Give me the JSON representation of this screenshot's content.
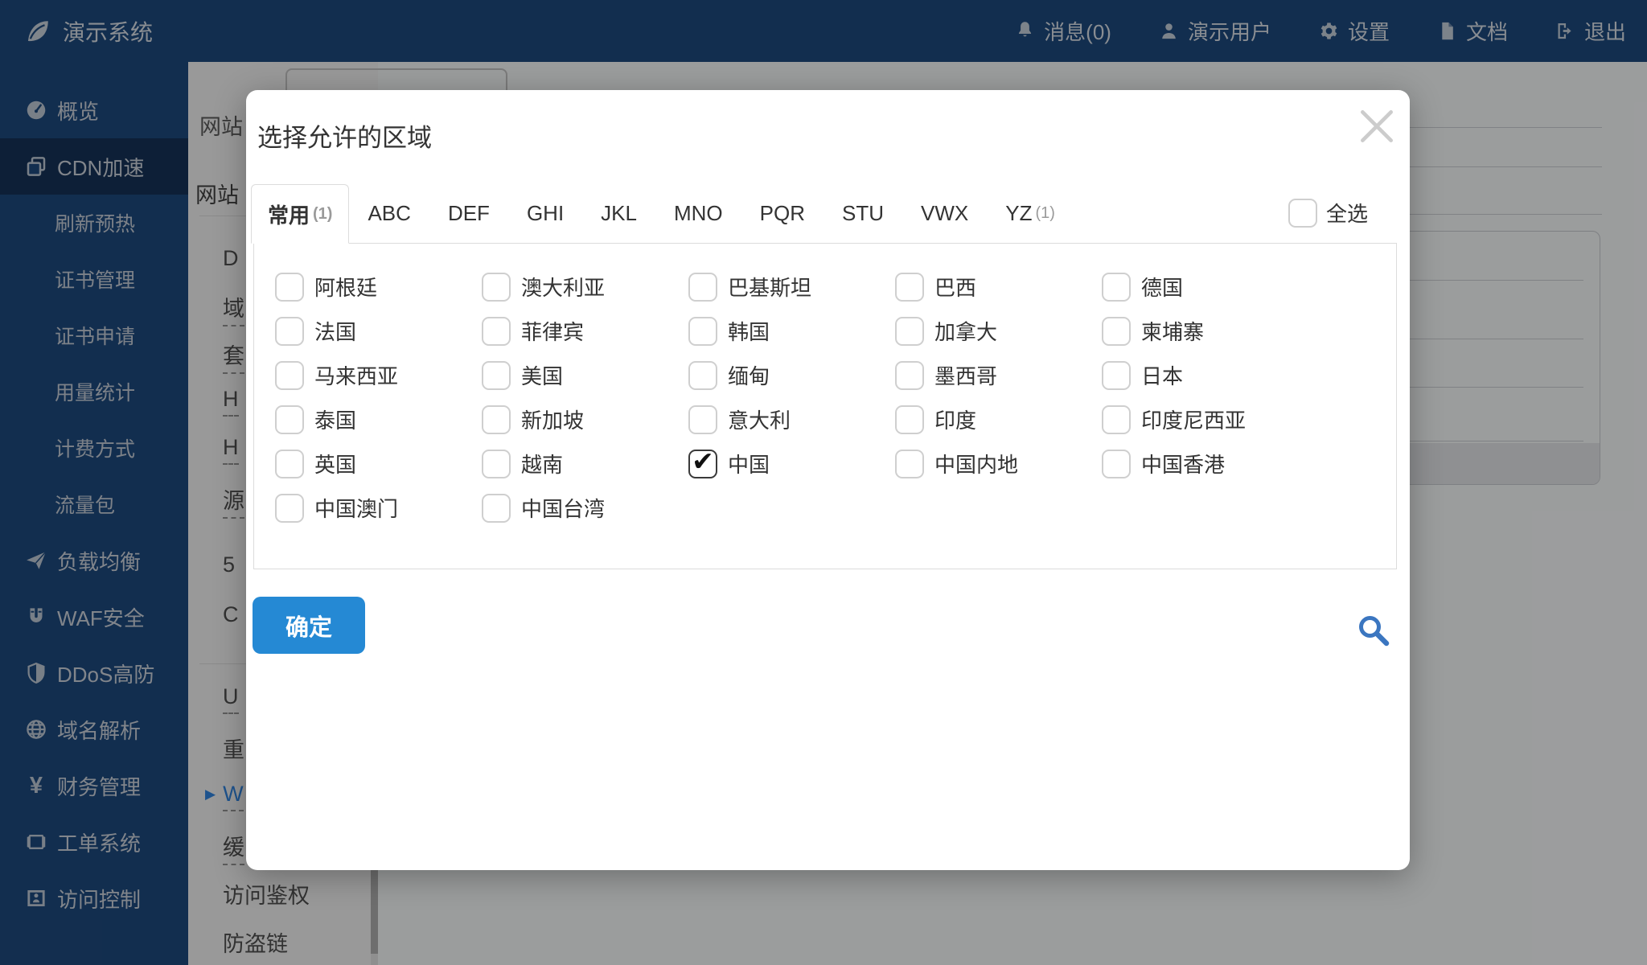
{
  "navbar": {
    "brand": "演示系统",
    "items": [
      {
        "icon": "bell-icon",
        "label": "消息(0)"
      },
      {
        "icon": "user-icon",
        "label": "演示用户"
      },
      {
        "icon": "gear-icon",
        "label": "设置"
      },
      {
        "icon": "document-icon",
        "label": "文档"
      },
      {
        "icon": "logout-icon",
        "label": "退出"
      }
    ]
  },
  "sidebar": {
    "items": [
      {
        "label": "概览",
        "icon": "gauge-icon",
        "level": "top",
        "active": false
      },
      {
        "label": "CDN加速",
        "icon": "layers-icon",
        "level": "top",
        "active": true
      },
      {
        "label": "刷新预热",
        "level": "sub"
      },
      {
        "label": "证书管理",
        "level": "sub"
      },
      {
        "label": "证书申请",
        "level": "sub"
      },
      {
        "label": "用量统计",
        "level": "sub"
      },
      {
        "label": "计费方式",
        "level": "sub"
      },
      {
        "label": "流量包",
        "level": "sub"
      },
      {
        "label": "负载均衡",
        "icon": "plane-icon",
        "level": "top"
      },
      {
        "label": "WAF安全",
        "icon": "magnet-icon",
        "level": "top"
      },
      {
        "label": "DDoS高防",
        "icon": "shield-icon",
        "level": "top"
      },
      {
        "label": "域名解析",
        "icon": "globe-icon",
        "level": "top"
      },
      {
        "label": "财务管理",
        "icon": "yen-icon",
        "level": "top"
      },
      {
        "label": "工单系统",
        "icon": "ticket-icon",
        "level": "top"
      },
      {
        "label": "访问控制",
        "icon": "idcard-icon",
        "level": "top"
      }
    ]
  },
  "submenu": {
    "header_fragment": "网站",
    "section_fragment": "网站",
    "items": [
      {
        "text": "D",
        "underlined": false,
        "active": false
      },
      {
        "text": "域",
        "underlined": true,
        "active": false
      },
      {
        "text": "套",
        "underlined": true,
        "active": false
      },
      {
        "text": "H",
        "underlined": true,
        "active": false
      },
      {
        "text": "H",
        "underlined": true,
        "active": false
      },
      {
        "text": "源",
        "underlined": true,
        "active": false
      },
      {
        "text": "5",
        "underlined": false,
        "active": false
      },
      {
        "text": "C",
        "underlined": false,
        "active": false
      },
      {
        "text": "U",
        "underlined": true,
        "active": false
      },
      {
        "text": "重",
        "underlined": false,
        "active": false
      },
      {
        "text": "W",
        "underlined": true,
        "active": true
      },
      {
        "text": "缓",
        "underlined": true,
        "active": false
      },
      {
        "text": "访问鉴权",
        "underlined": false,
        "active": false
      },
      {
        "text": "防盗链",
        "underlined": false,
        "active": false
      }
    ]
  },
  "modal": {
    "title": "选择允许的区域",
    "tabs": [
      {
        "label": "常用",
        "count": "(1)",
        "active": true
      },
      {
        "label": "ABC",
        "count": "",
        "active": false
      },
      {
        "label": "DEF",
        "count": "",
        "active": false
      },
      {
        "label": "GHI",
        "count": "",
        "active": false
      },
      {
        "label": "JKL",
        "count": "",
        "active": false
      },
      {
        "label": "MNO",
        "count": "",
        "active": false
      },
      {
        "label": "PQR",
        "count": "",
        "active": false
      },
      {
        "label": "STU",
        "count": "",
        "active": false
      },
      {
        "label": "VWX",
        "count": "",
        "active": false
      },
      {
        "label": "YZ",
        "count": "(1)",
        "active": false
      }
    ],
    "select_all_label": "全选",
    "regions": [
      {
        "label": "阿根廷",
        "checked": false
      },
      {
        "label": "澳大利亚",
        "checked": false
      },
      {
        "label": "巴基斯坦",
        "checked": false
      },
      {
        "label": "巴西",
        "checked": false
      },
      {
        "label": "德国",
        "checked": false
      },
      {
        "label": "法国",
        "checked": false
      },
      {
        "label": "菲律宾",
        "checked": false
      },
      {
        "label": "韩国",
        "checked": false
      },
      {
        "label": "加拿大",
        "checked": false
      },
      {
        "label": "柬埔寨",
        "checked": false
      },
      {
        "label": "马来西亚",
        "checked": false
      },
      {
        "label": "美国",
        "checked": false
      },
      {
        "label": "缅甸",
        "checked": false
      },
      {
        "label": "墨西哥",
        "checked": false
      },
      {
        "label": "日本",
        "checked": false
      },
      {
        "label": "泰国",
        "checked": false
      },
      {
        "label": "新加坡",
        "checked": false
      },
      {
        "label": "意大利",
        "checked": false
      },
      {
        "label": "印度",
        "checked": false
      },
      {
        "label": "印度尼西亚",
        "checked": false
      },
      {
        "label": "英国",
        "checked": false
      },
      {
        "label": "越南",
        "checked": false
      },
      {
        "label": "中国",
        "checked": true
      },
      {
        "label": "中国内地",
        "checked": false
      },
      {
        "label": "中国香港",
        "checked": false
      },
      {
        "label": "中国澳门",
        "checked": false
      },
      {
        "label": "中国台湾",
        "checked": false
      }
    ],
    "confirm_label": "确定",
    "accent_color": "#2589d4",
    "search_icon_color": "#3b76c0"
  }
}
